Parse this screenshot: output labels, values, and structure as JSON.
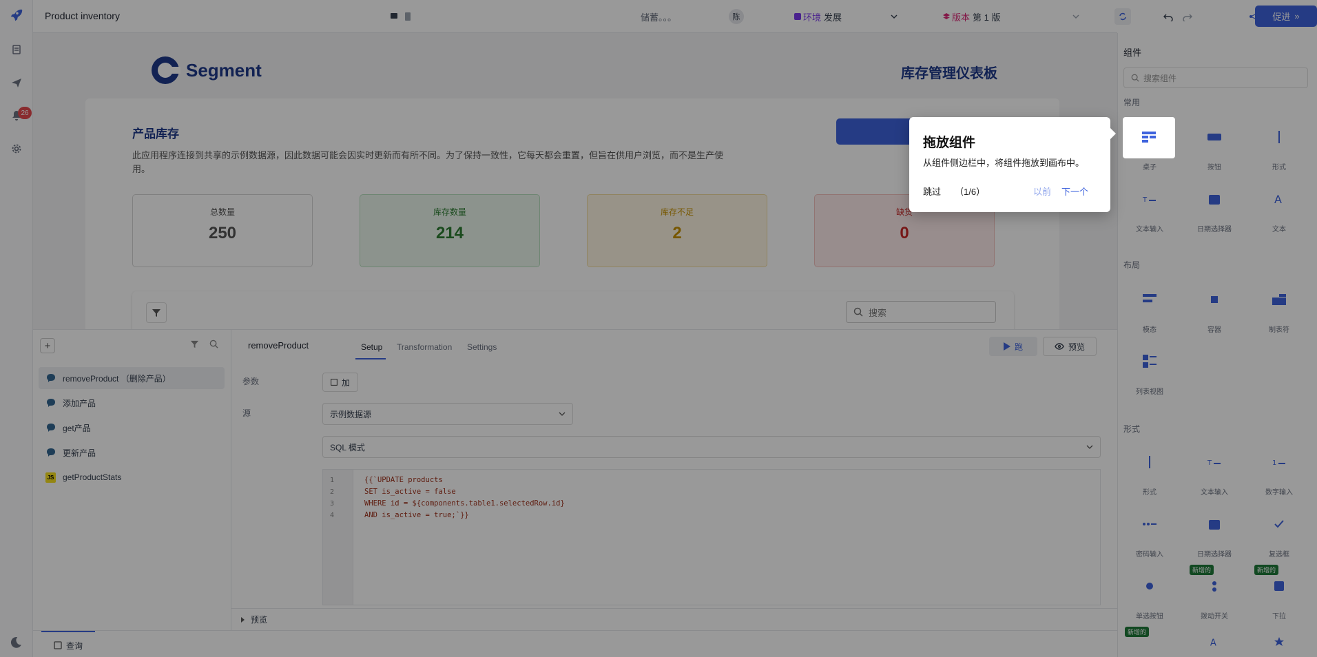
{
  "app": {
    "title": "Product inventory"
  },
  "header": {
    "saving": "储蓄。。。",
    "user_initial": "陈",
    "env_label": "环境",
    "env_value": "发展",
    "version_label": "版本",
    "version_value": "第 1 版",
    "promote_label": "促进"
  },
  "rail": {
    "notification_count": "26"
  },
  "canvas": {
    "logo_text": "Segment",
    "dashboard_title": "库存管理仪表板",
    "section_title": "产品库存",
    "description": "此应用程序连接到共享的示例数据源，因此数据可能会因实时更新而有所不同。为了保持一致性，它每天都会重置，但旨在供用户浏览，而不是生产使用。",
    "stats": [
      {
        "label": "总数量",
        "value": "250",
        "color": "#555555"
      },
      {
        "label": "库存数量",
        "value": "214",
        "color": "#2e7d32"
      },
      {
        "label": "库存不足",
        "value": "2",
        "color": "#c79100"
      },
      {
        "label": "缺货",
        "value": "0",
        "color": "#c62828"
      }
    ],
    "table_search_placeholder": "搜索"
  },
  "query_panel": {
    "queries": [
      {
        "name": "removeProduct （删除产品）",
        "kind": "postgres"
      },
      {
        "name": "添加产品",
        "kind": "postgres"
      },
      {
        "name": "get产品",
        "kind": "postgres"
      },
      {
        "name": "更新产品",
        "kind": "postgres"
      },
      {
        "name": "getProductStats",
        "kind": "js"
      }
    ],
    "js_tag": "JS",
    "selected_query": "removeProduct",
    "tabs": [
      "Setup",
      "Transformation",
      "Settings"
    ],
    "run_label": "跑",
    "preview_label": "预览",
    "params_label": "参数",
    "add_param_label": "加",
    "source_label": "源",
    "source_value": "示例数据源",
    "mode_value": "SQL 模式",
    "code_lines": [
      {
        "n": "1",
        "text": "{{`UPDATE products"
      },
      {
        "n": "2",
        "text": "SET is_active = false"
      },
      {
        "n": "3",
        "text": "WHERE id = ${components.table1.selectedRow.id}"
      },
      {
        "n": "4",
        "text": "AND is_active = true;`}}"
      }
    ],
    "preview_section": "预览",
    "bottom_tab": "查询"
  },
  "sidebar": {
    "title": "组件",
    "search_placeholder": "搜索组件",
    "sections": {
      "common": "常用",
      "layout": "布局",
      "form": "形式"
    },
    "common_items": [
      "桌子",
      "按钮",
      "形式",
      "文本输入",
      "日期选择器",
      "文本"
    ],
    "layout_items": [
      "模态",
      "容器",
      "制表符",
      "列表视图"
    ],
    "form_items": [
      "形式",
      "文本输入",
      "数字输入",
      "密码输入",
      "日期选择器",
      "复选框",
      "单选按钮",
      "拨动开关",
      "下拉"
    ],
    "new_tag": "新增的"
  },
  "popover": {
    "title": "拖放组件",
    "body": "从组件侧边栏中，将组件拖放到画布中。",
    "skip": "跳过",
    "step": "（1/6）",
    "prev": "以前",
    "next": "下一个"
  }
}
